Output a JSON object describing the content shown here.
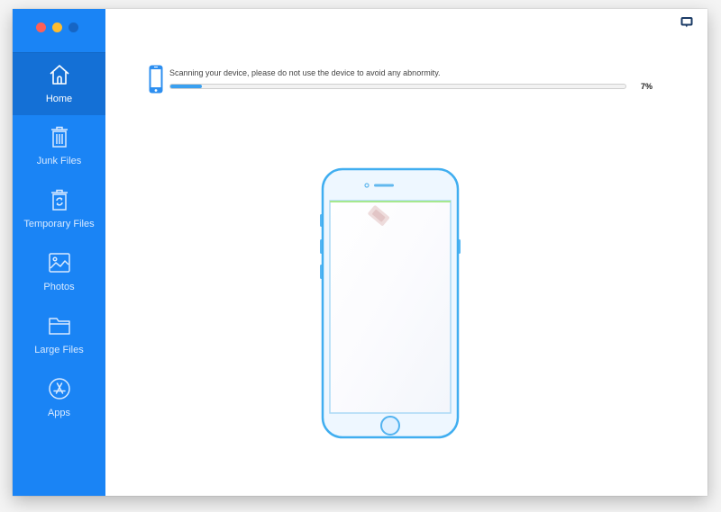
{
  "window": {
    "traffic_lights": [
      "close",
      "minimize",
      "zoom"
    ]
  },
  "sidebar": {
    "accent_color": "#1a84f5",
    "active_color": "#1470d6",
    "items": [
      {
        "label": "Home",
        "icon": "home-icon",
        "active": true
      },
      {
        "label": "Junk Files",
        "icon": "trash-icon",
        "active": false
      },
      {
        "label": "Temporary Files",
        "icon": "recycle-bin-icon",
        "active": false
      },
      {
        "label": "Photos",
        "icon": "image-icon",
        "active": false
      },
      {
        "label": "Large Files",
        "icon": "folder-icon",
        "active": false
      },
      {
        "label": "Apps",
        "icon": "app-store-icon",
        "active": false
      }
    ]
  },
  "main": {
    "feedback_icon": "feedback-icon",
    "scan": {
      "message": "Scanning your device, please do not use the device to avoid any abnormity.",
      "progress_percent": 7,
      "progress_label": "7%"
    },
    "device_illustration": "phone-scanning-icon"
  }
}
